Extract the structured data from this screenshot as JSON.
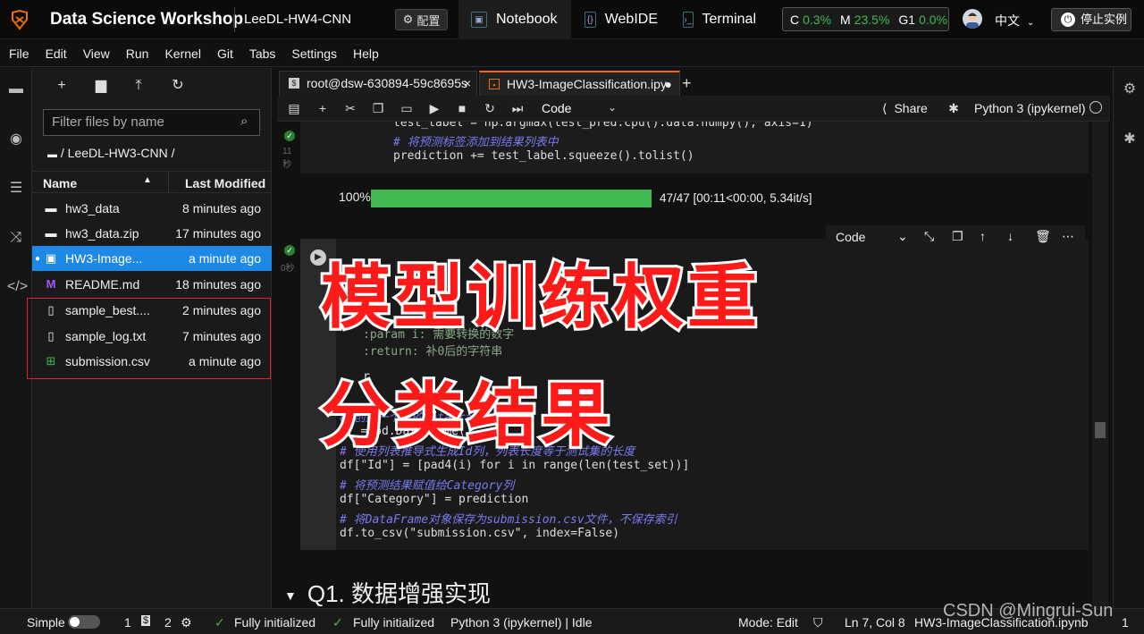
{
  "app": {
    "title": "Data Science Workshop",
    "project": "LeeDL-HW4-CNN",
    "config_label": "配置",
    "tabs": [
      "Notebook",
      "WebIDE",
      "Terminal"
    ],
    "resources": {
      "c_label": "C",
      "c_value": "0.3%",
      "m_label": "M",
      "m_value": "23.5%",
      "g_label": "G1",
      "g_value": "0.0%"
    },
    "language": "中文",
    "stop_label": "停止实例",
    "accent": "#ef6c00",
    "green": "#3fb950"
  },
  "menu": [
    "File",
    "Edit",
    "View",
    "Run",
    "Kernel",
    "Git",
    "Tabs",
    "Settings",
    "Help"
  ],
  "filebrowser": {
    "filter_placeholder": "Filter files by name",
    "breadcrumb": "/ LeeDL-HW3-CNN /",
    "col_name": "Name",
    "col_modified": "Last Modified",
    "files": [
      {
        "name": "hw3_data",
        "modified": "8 minutes ago",
        "icon": "folder-icon"
      },
      {
        "name": "hw3_data.zip",
        "modified": "17 minutes ago",
        "icon": "folder-icon"
      },
      {
        "name": "HW3-Image...",
        "modified": "a minute ago",
        "icon": "notebook-icon"
      },
      {
        "name": "README.md",
        "modified": "18 minutes ago",
        "icon": "markdown-icon"
      },
      {
        "name": "sample_best....",
        "modified": "2 minutes ago",
        "icon": "file-icon"
      },
      {
        "name": "sample_log.txt",
        "modified": "7 minutes ago",
        "icon": "file-icon"
      },
      {
        "name": "submission.csv",
        "modified": "a minute ago",
        "icon": "spreadsheet-icon"
      }
    ]
  },
  "notebook": {
    "tab_terminal": "root@dsw-630894-59c8695s",
    "tab_notebook": "HW3-ImageClassification.ipy",
    "celltype": "Code",
    "share": "Share",
    "kernel": "Python 3 (ipykernel)",
    "cell1_time": "11\n秒",
    "cell1_lines": [
      "test_label = np.argmax(test_pred.cpu().data.numpy(), axis=1)",
      "# 将预测标签添加到结果列表中",
      "prediction += test_label.squeeze().tolist()"
    ],
    "progress_pct": "100%",
    "progress_fraction": 1.0,
    "progress_stats": "47/47  [00:11<00:00,    5.34it/s]",
    "cell2_time": "0秒",
    "cell2_toolbar_type": "Code",
    "cell2_lines": [
      ":param i: 需要转换的数字",
      ":return: 补0后的字符串",
      "r",
      "# 创建一个空的DataFrame",
      "df = pd.DataFrame()",
      "# 使用列表推导式生成Id列，列表长度等于测试集的长度",
      "df[\"Id\"] = [pad4(i) for i in range(len(test_set))]",
      "# 将预测结果赋值给Category列",
      "df[\"Category\"] = prediction",
      "# 将DataFrame对象保存为submission.csv文件，不保存索引",
      "df.to_csv(\"submission.csv\", index=False)"
    ],
    "overlay_line1": "模型训练权重",
    "overlay_line2": "分类结果",
    "section_heading": "Q1. 数据增强实现"
  },
  "status": {
    "mode_label": "Simple",
    "count1": "1",
    "count2": "2",
    "init1": "Fully initialized",
    "init2": "Fully initialized",
    "kernel_status": "Python 3 (ipykernel) | Idle",
    "edit_mode": "Mode: Edit",
    "position": "Ln 7, Col 8",
    "file": "HW3-ImageClassification.ipynb",
    "right_count": "1",
    "watermark": "CSDN @Mingrui-Sun"
  }
}
